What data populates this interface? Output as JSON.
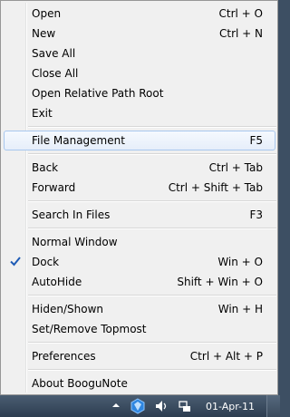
{
  "menu": {
    "items": [
      {
        "label": "Open",
        "shortcut": "Ctrl + O"
      },
      {
        "label": "New",
        "shortcut": "Ctrl + N"
      },
      {
        "label": "Save All",
        "shortcut": ""
      },
      {
        "label": "Close All",
        "shortcut": ""
      },
      {
        "label": "Open Relative Path Root",
        "shortcut": ""
      },
      {
        "label": "Exit",
        "shortcut": ""
      },
      {
        "label": "File Management",
        "shortcut": "F5"
      },
      {
        "label": "Back",
        "shortcut": "Ctrl + Tab"
      },
      {
        "label": "Forward",
        "shortcut": "Ctrl + Shift + Tab"
      },
      {
        "label": "Search In Files",
        "shortcut": "F3"
      },
      {
        "label": "Normal Window",
        "shortcut": ""
      },
      {
        "label": "Dock",
        "shortcut": "Win + O",
        "checked": true
      },
      {
        "label": "AutoHide",
        "shortcut": "Shift + Win + O"
      },
      {
        "label": "Hiden/Shown",
        "shortcut": "Win + H"
      },
      {
        "label": "Set/Remove Topmost",
        "shortcut": ""
      },
      {
        "label": "Preferences",
        "shortcut": "Ctrl + Alt + P"
      },
      {
        "label": "About BooguNote",
        "shortcut": ""
      }
    ]
  },
  "taskbar": {
    "date": "01-Apr-11"
  },
  "colors": {
    "menu_bg": "#f0f0f0",
    "highlight_border": "#a8c7ee",
    "taskbar": "#3d4f63",
    "check": "#1e5bb5"
  }
}
